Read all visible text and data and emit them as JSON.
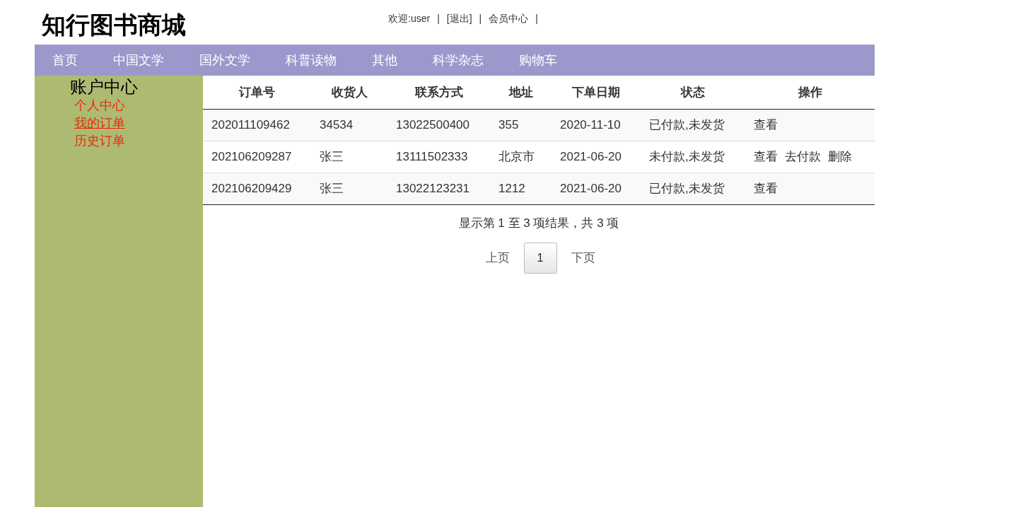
{
  "logo": "知行图书商城",
  "top_links": [
    {
      "kind": "text",
      "label": "欢迎:user"
    },
    {
      "kind": "separator",
      "label": "|"
    },
    {
      "kind": "link",
      "label": "[退出]"
    },
    {
      "kind": "separator",
      "label": "|"
    },
    {
      "kind": "link",
      "label": "会员中心"
    },
    {
      "kind": "separator",
      "label": "|"
    }
  ],
  "nav": [
    "首页",
    "中国文学",
    "国外文学",
    "科普读物",
    "其他",
    "科学杂志",
    "购物车"
  ],
  "sidebar": {
    "title": "账户中心",
    "items": [
      {
        "label": "个人中心",
        "selected": false
      },
      {
        "label": "我的订单",
        "selected": true
      },
      {
        "label": "历史订单",
        "selected": false
      }
    ]
  },
  "table": {
    "columns": [
      "订单号",
      "收货人",
      "联系方式",
      "地址",
      "下单日期",
      "状态",
      "操作"
    ],
    "rows": [
      {
        "cells": [
          "202011109462",
          "34534",
          "13022500400",
          "355",
          "2020-11-10",
          "已付款,未发货"
        ],
        "actions": [
          "查看"
        ]
      },
      {
        "cells": [
          "202106209287",
          "张三",
          "13111502333",
          "北京市",
          "2021-06-20",
          "未付款,未发货"
        ],
        "actions": [
          "查看",
          "去付款",
          "删除"
        ]
      },
      {
        "cells": [
          "202106209429",
          "张三",
          "13022123231",
          "1212",
          "2021-06-20",
          "已付款,未发货"
        ],
        "actions": [
          "查看"
        ]
      }
    ]
  },
  "summary": "显示第 1 至 3 项结果，共 3 项",
  "pagination": {
    "prev": "上页",
    "pages": [
      {
        "label": "1",
        "selected": true
      }
    ],
    "next": "下页"
  }
}
